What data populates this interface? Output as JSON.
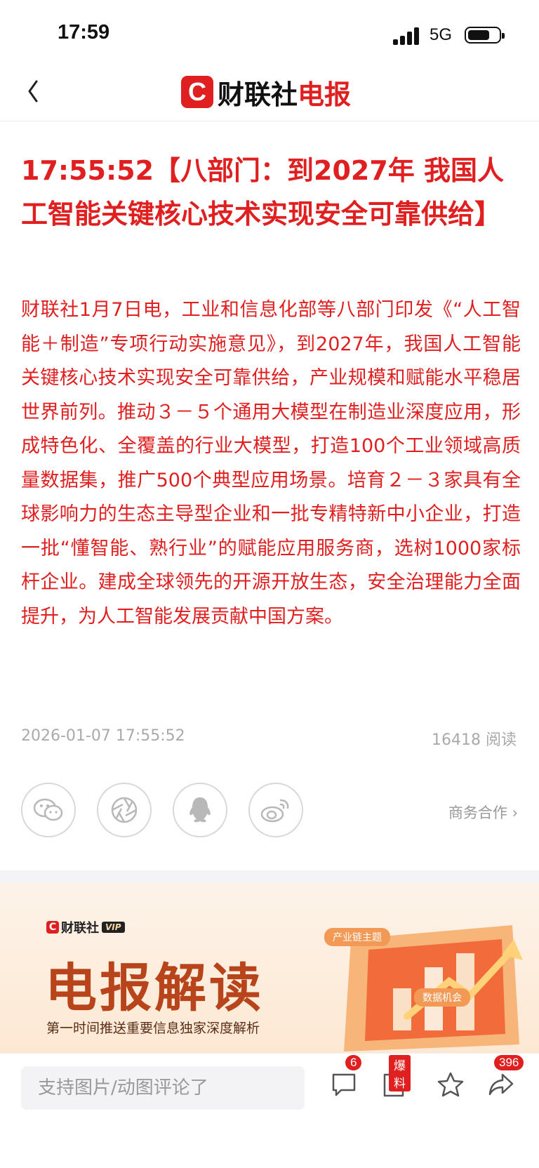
{
  "status_bar": {
    "time": "17:59",
    "network": "5G"
  },
  "nav": {
    "logo_mark": "C",
    "logo_text_black": "财联社",
    "logo_text_red": "电报"
  },
  "article": {
    "headline": "17:55:52【八部门：到2027年 我国人工智能关键核心技术实现安全可靠供给】",
    "body": "财联社1月7日电，工业和信息化部等八部门印发《“人工智能＋制造”专项行动实施意见》，到2027年，我国人工智能关键核心技术实现安全可靠供给，产业规模和赋能水平稳居世界前列。推动３－５个通用大模型在制造业深度应用，形成特色化、全覆盖的行业大模型，打造100个工业领域高质量数据集，推广500个典型应用场景。培育２－３家具有全球影响力的生态主导型企业和一批专精特新中小企业，打造一批“懂智能、熟行业”的赋能应用服务商，选树1000家标杆企业。建成全球领先的开源开放生态，安全治理能力全面提升，为人工智能发展贡献中国方案。",
    "datetime": "2026-01-07 17:55:52",
    "reads": "16418 阅读"
  },
  "share": {
    "business_link": "商务合作 ›"
  },
  "banner": {
    "brand": "财联社",
    "vip": "VIP",
    "title": "电报解读",
    "subtitle": "第一时间推送重要信息独家深度解析",
    "tag1": "产业链主题",
    "tag2": "数据机会"
  },
  "bottom_bar": {
    "comment_placeholder": "支持图片/动图评论了",
    "comment_count": "6",
    "report_badge": "爆料",
    "share_count": "396"
  },
  "colors": {
    "accent": "#e02020",
    "meta": "#aaaaaa"
  }
}
